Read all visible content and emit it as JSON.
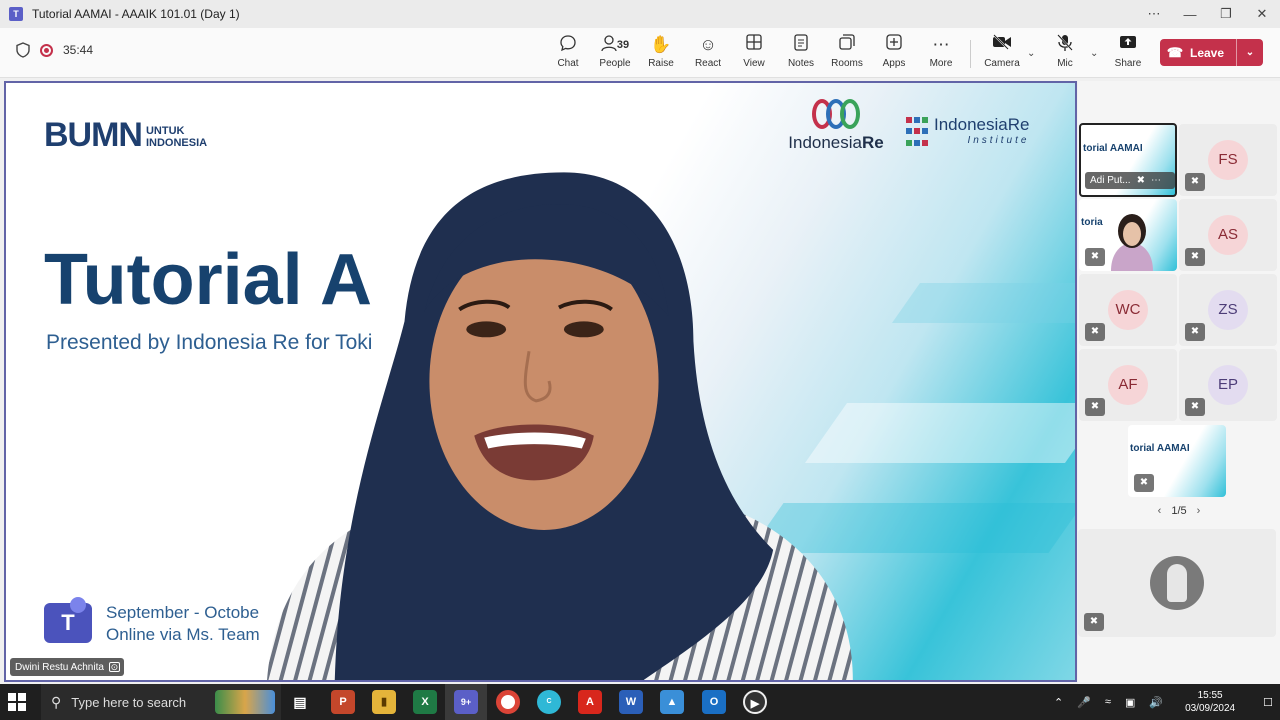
{
  "window": {
    "title": "Tutorial AAMAI - AAAIK 101.01 (Day 1)",
    "controls": [
      "⋯",
      "—",
      "❐",
      "✕"
    ]
  },
  "toolbar": {
    "timer": "35:44",
    "people_count": "39",
    "items": [
      {
        "label": "Chat",
        "icon": "chat-icon"
      },
      {
        "label": "People",
        "icon": "people-icon"
      },
      {
        "label": "Raise",
        "icon": "raise-hand-icon"
      },
      {
        "label": "React",
        "icon": "react-icon"
      },
      {
        "label": "View",
        "icon": "view-icon"
      },
      {
        "label": "Notes",
        "icon": "notes-icon"
      },
      {
        "label": "Rooms",
        "icon": "rooms-icon"
      },
      {
        "label": "Apps",
        "icon": "apps-icon"
      },
      {
        "label": "More",
        "icon": "more-icon"
      },
      {
        "label": "Camera",
        "icon": "camera-off-icon"
      },
      {
        "label": "Mic",
        "icon": "mic-off-icon"
      },
      {
        "label": "Share",
        "icon": "share-icon"
      }
    ],
    "leave_label": "Leave"
  },
  "slide": {
    "bumn_big": "BUMN",
    "bumn_small_1": "UNTUK",
    "bumn_small_2": "INDONESIA",
    "ire_logo_a": "Indonesia",
    "ire_logo_b": "Re",
    "iri_logo": "IndonesiaRe",
    "iri_logo_sub": "Institute",
    "title": "Tutorial A",
    "subtitle": "Presented by Indonesia Re for Toki",
    "date_line": "September - Octobe",
    "venue_line": "Online via Ms. Team"
  },
  "presenter": {
    "name": "Dwini Restu Achnita"
  },
  "participants": [
    {
      "initials": "FS",
      "bg": "#f6d5d7",
      "fg": "#8a2b35"
    },
    {
      "initials": "AS",
      "bg": "#f6d5d7",
      "fg": "#8a2b35"
    },
    {
      "initials": "WC",
      "bg": "#f6d5d7",
      "fg": "#8a2b35"
    },
    {
      "initials": "ZS",
      "bg": "#e3dcf0",
      "fg": "#4d3d78"
    },
    {
      "initials": "AF",
      "bg": "#f6d5d7",
      "fg": "#8a2b35"
    },
    {
      "initials": "EP",
      "bg": "#e3dcf0",
      "fg": "#4d3d78"
    }
  ],
  "panel": {
    "share_tile_title": "torial AAMAI",
    "share_tile_name": "Adi Put...",
    "second_tile_title": "toria",
    "bottom_tile_title": "torial AAMAI",
    "pager": "1/5"
  },
  "taskbar": {
    "search_placeholder": "Type here to search",
    "time": "15:55",
    "date": "03/09/2024",
    "teams_badge": "9+"
  },
  "colors": {
    "leave": "#c4314b",
    "teams_accent": "#6264a7",
    "slide_title": "#17426e"
  }
}
